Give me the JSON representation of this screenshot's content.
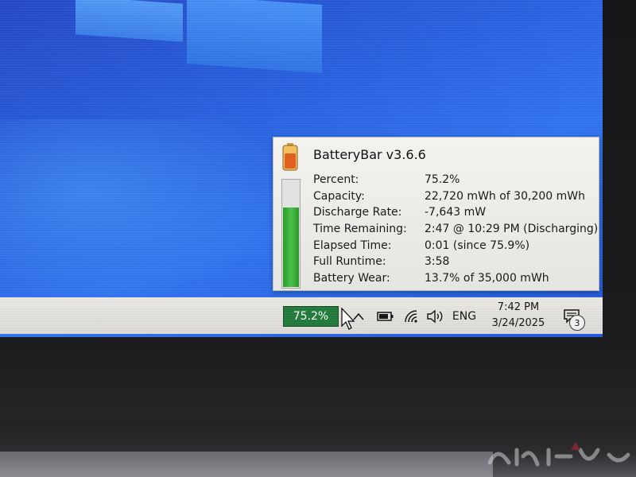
{
  "tooltip": {
    "title": "BatteryBar v3.6.6",
    "rows": [
      {
        "label": "Percent:",
        "value": "75.2%"
      },
      {
        "label": "Capacity:",
        "value": "22,720 mWh of 30,200 mWh"
      },
      {
        "label": "Discharge Rate:",
        "value": "-7,643 mW"
      },
      {
        "label": "Time Remaining:",
        "value": "2:47 @ 10:29 PM (Discharging)"
      },
      {
        "label": "Elapsed Time:",
        "value": "0:01 (since 75.9%)"
      },
      {
        "label": "Full Runtime:",
        "value": "3:58"
      },
      {
        "label": "Battery Wear:",
        "value": "13.7% of 35,000 mWh"
      }
    ],
    "charge_level": 0.752
  },
  "taskbar": {
    "battery_badge": "75.2%",
    "language": "ENG",
    "time": "7:42 PM",
    "date": "3/24/2025",
    "notification_count": "3",
    "icons": [
      "chevron-up-icon",
      "battery-icon",
      "wifi-icon",
      "volume-icon",
      "action-center-icon"
    ]
  },
  "colors": {
    "desktop_blue": "#2760e0",
    "battery_green": "#1f7a3a",
    "meter_green": "#4cc04c"
  }
}
